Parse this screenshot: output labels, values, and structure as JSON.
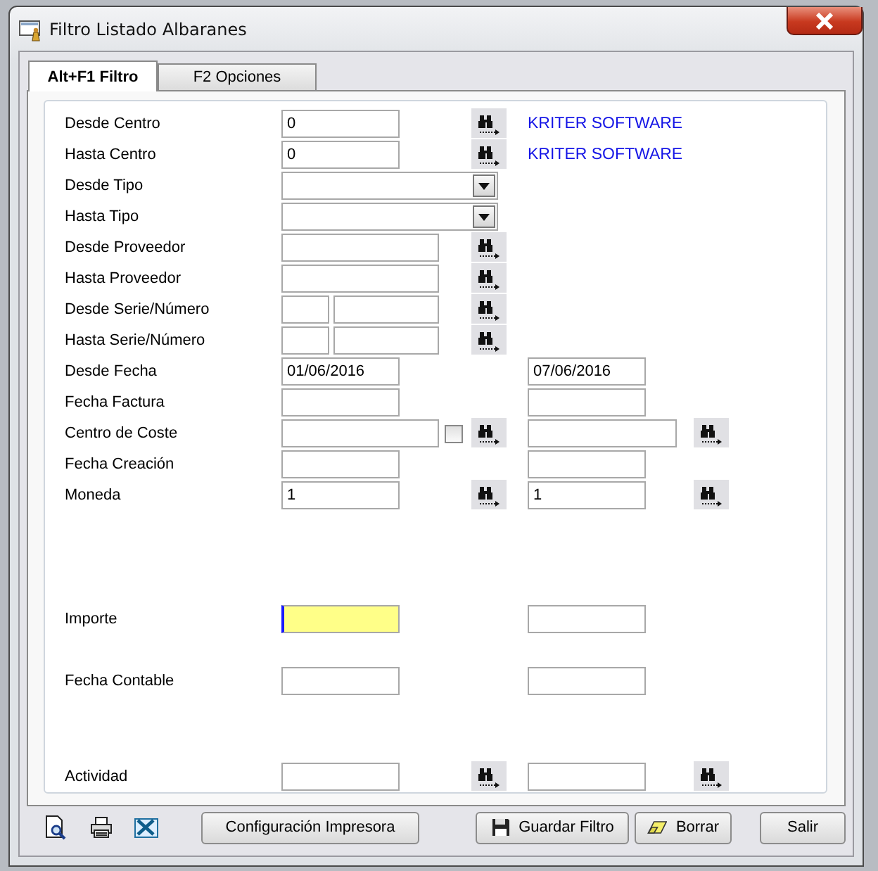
{
  "window": {
    "title": "Filtro Listado Albaranes"
  },
  "tabs": [
    {
      "label": "Alt+F1 Filtro",
      "selected": true
    },
    {
      "label": "F2 Opciones",
      "selected": false
    }
  ],
  "sections": [
    {
      "rows": [
        {
          "label": "Desde Centro",
          "a": [
            {
              "kind": "code",
              "value": "0"
            }
          ],
          "a_lookup": true,
          "b": [
            {
              "kind": "note",
              "text": "KRITER SOFTWARE"
            }
          ]
        },
        {
          "label": "Hasta Centro",
          "a": [
            {
              "kind": "code",
              "value": "0"
            }
          ],
          "a_lookup": true,
          "b": [
            {
              "kind": "note",
              "text": "KRITER SOFTWARE"
            }
          ]
        },
        {
          "label": "Desde Tipo",
          "a": [
            {
              "kind": "combo"
            }
          ],
          "a_lookup": false,
          "b": []
        },
        {
          "label": "Hasta Tipo",
          "a": [
            {
              "kind": "combo"
            }
          ],
          "a_lookup": false,
          "b": []
        },
        {
          "label": "Desde Proveedor",
          "a": [
            {
              "kind": "text"
            }
          ],
          "a_lookup": true,
          "b": []
        },
        {
          "label": "Hasta Proveedor",
          "a": [
            {
              "kind": "text"
            }
          ],
          "a_lookup": true,
          "b": []
        },
        {
          "label": "Desde Serie/Número",
          "a": [
            {
              "kind": "serie"
            },
            {
              "kind": "number"
            }
          ],
          "a_lookup": true,
          "b": []
        },
        {
          "label": "Hasta Serie/Número",
          "a": [
            {
              "kind": "serie"
            },
            {
              "kind": "number"
            }
          ],
          "a_lookup": true,
          "b": []
        },
        {
          "label": "Desde Fecha",
          "a": [
            {
              "kind": "code",
              "value": "01/06/2016"
            }
          ],
          "a_lookup": false,
          "b": [
            {
              "kind": "code",
              "value": "07/06/2016"
            }
          ]
        },
        {
          "label": "Fecha Factura",
          "a": [
            {
              "kind": "code"
            }
          ],
          "a_lookup": false,
          "b": [
            {
              "kind": "code"
            }
          ]
        },
        {
          "label": "Centro de Coste",
          "a": [
            {
              "kind": "text"
            },
            {
              "kind": "check",
              "checked": false
            }
          ],
          "a_lookup": true,
          "b": [
            {
              "kind": "wide"
            }
          ],
          "b_lookup": true
        },
        {
          "label": "Fecha Creación",
          "a": [
            {
              "kind": "code"
            }
          ],
          "a_lookup": false,
          "b": [
            {
              "kind": "code"
            }
          ]
        },
        {
          "label": "Moneda",
          "a": [
            {
              "kind": "code",
              "value": "1"
            }
          ],
          "a_lookup": true,
          "b": [
            {
              "kind": "code",
              "value": "1"
            }
          ],
          "b_lookup": true
        }
      ]
    },
    {
      "rows": [
        {
          "label": "Importe",
          "a": [
            {
              "kind": "code",
              "focused": true
            }
          ],
          "a_lookup": false,
          "b": [
            {
              "kind": "code"
            }
          ]
        }
      ]
    },
    {
      "rows": [
        {
          "label": "Fecha Contable",
          "a": [
            {
              "kind": "code"
            }
          ],
          "a_lookup": false,
          "b": [
            {
              "kind": "code"
            }
          ]
        }
      ]
    },
    {
      "rows": [
        {
          "label": "Actividad",
          "a": [
            {
              "kind": "code"
            }
          ],
          "a_lookup": true,
          "b": [
            {
              "kind": "code"
            }
          ],
          "b_lookup": true
        }
      ]
    }
  ],
  "toolbar": [
    {
      "kind": "preview"
    },
    {
      "kind": "print"
    },
    {
      "kind": "excel"
    }
  ],
  "buttons": [
    {
      "kind": "plain",
      "label": "Configuración Impresora"
    },
    {
      "kind": "save",
      "label": "Guardar Filtro"
    },
    {
      "kind": "erase",
      "label": "Borrar"
    },
    {
      "kind": "exit",
      "label": "Salir"
    }
  ]
}
